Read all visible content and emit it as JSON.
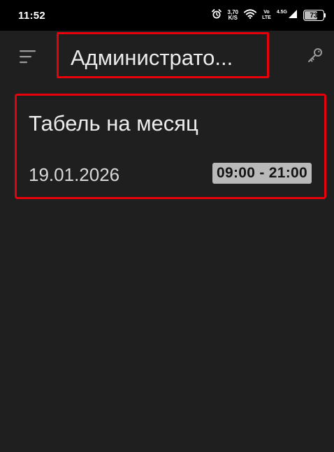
{
  "status_bar": {
    "time": "11:52",
    "net_speed_value": "3,70",
    "net_speed_unit": "K/S",
    "volte_top": "Vo",
    "volte_bottom": "LTE",
    "network_type": "4.5G",
    "battery_level": "73",
    "icons": [
      "alarm-icon",
      "wifi-icon",
      "signal-icon",
      "battery-icon"
    ]
  },
  "app_bar": {
    "title": "Администрато...",
    "icons": [
      "menu-icon",
      "key-icon"
    ]
  },
  "cards": [
    {
      "title": "Табель на месяц",
      "date": "19.01.2026",
      "time_range": "09:00 - 21:00"
    }
  ],
  "colors": {
    "background": "#1f1f1f",
    "status_bar": "#000000",
    "highlight_border": "#e8000b",
    "time_badge": "#b9b9b9"
  }
}
